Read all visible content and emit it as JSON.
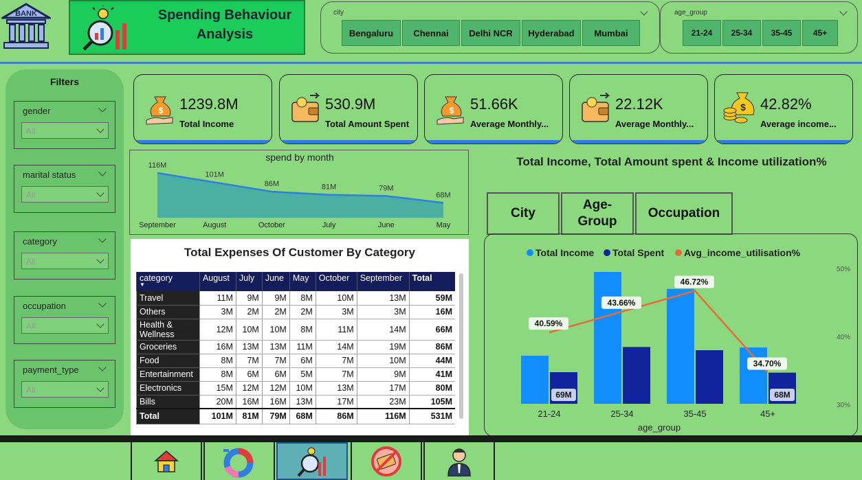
{
  "header": {
    "bank_logo_text": "BANK",
    "title_line1": "Spending Behaviour",
    "title_line2": "Analysis"
  },
  "slicers": {
    "city": {
      "label": "city",
      "options": [
        "Bengaluru",
        "Chennai",
        "Delhi NCR",
        "Hyderabad",
        "Mumbai"
      ]
    },
    "age_group": {
      "label": "age_group",
      "options": [
        "21-24",
        "25-34",
        "35-45",
        "45+"
      ]
    }
  },
  "filters": {
    "title": "Filters",
    "items": [
      {
        "label": "gender",
        "value": "All"
      },
      {
        "label": "marital status",
        "value": "All"
      },
      {
        "label": "category",
        "value": "All"
      },
      {
        "label": "occupation",
        "value": "All"
      },
      {
        "label": "payment_type",
        "value": "All"
      }
    ]
  },
  "kpis": [
    {
      "value": "1239.8M",
      "label": "Total Income",
      "icon": "money-bag-hand-icon"
    },
    {
      "value": "530.9M",
      "label": "Total Amount Spent",
      "icon": "wallet-icon"
    },
    {
      "value": "51.66K",
      "label": "Average Monthly...",
      "icon": "money-bag-hand-icon"
    },
    {
      "value": "22.12K",
      "label": "Average Monthly...",
      "icon": "wallet-icon"
    },
    {
      "value": "42.82%",
      "label": "Average income...",
      "icon": "gold-coins-icon"
    }
  ],
  "spend_chart": {
    "title": "spend by month",
    "chart_data": {
      "type": "area",
      "categories": [
        "September",
        "August",
        "October",
        "July",
        "June",
        "May"
      ],
      "values": [
        116,
        101,
        86,
        81,
        79,
        68
      ],
      "data_labels": [
        "116M",
        "101M",
        "86M",
        "81M",
        "79M",
        "68M"
      ],
      "ylim": [
        0,
        130
      ]
    }
  },
  "expenses_table": {
    "title": "Total Expenses Of Customer By Category",
    "columns": [
      "category",
      "August",
      "July",
      "June",
      "May",
      "October",
      "September",
      "Total"
    ],
    "rows": [
      [
        "Travel",
        "11M",
        "9M",
        "9M",
        "8M",
        "10M",
        "13M",
        "59M"
      ],
      [
        "Others",
        "3M",
        "2M",
        "2M",
        "2M",
        "3M",
        "3M",
        "16M"
      ],
      [
        "Health & Wellness",
        "12M",
        "10M",
        "10M",
        "8M",
        "11M",
        "14M",
        "66M"
      ],
      [
        "Groceries",
        "16M",
        "13M",
        "13M",
        "11M",
        "14M",
        "19M",
        "86M"
      ],
      [
        "Food",
        "8M",
        "7M",
        "7M",
        "6M",
        "7M",
        "10M",
        "44M"
      ],
      [
        "Entertainment",
        "8M",
        "6M",
        "6M",
        "5M",
        "7M",
        "9M",
        "41M"
      ],
      [
        "Electronics",
        "15M",
        "12M",
        "12M",
        "10M",
        "13M",
        "17M",
        "80M"
      ],
      [
        "Bills",
        "20M",
        "16M",
        "16M",
        "13M",
        "17M",
        "23M",
        "105M"
      ]
    ],
    "total_row": [
      "Total",
      "101M",
      "81M",
      "79M",
      "68M",
      "86M",
      "116M",
      "531M"
    ]
  },
  "combo": {
    "title": "Total Income, Total Amount spent & Income utilization%",
    "buttons": [
      "City",
      "Age-Group",
      "Occupation"
    ],
    "legend": [
      "Total Income",
      "Total Spent",
      "Avg_income_utilisation%"
    ],
    "colors": {
      "income": "#118dff",
      "spent": "#12239e",
      "line": "#e66c37"
    },
    "chart_data": {
      "type": "bar",
      "xlabel": "age_group",
      "categories": [
        "21-24",
        "25-34",
        "35-45",
        "45+"
      ],
      "series": [
        {
          "name": "Total Income",
          "values": [
            105,
            288,
            251,
            123
          ]
        },
        {
          "name": "Total Spent",
          "values": [
            69,
            124,
            117,
            68
          ]
        },
        {
          "name": "Avg_income_utilisation%",
          "values": [
            40.59,
            43.66,
            46.72,
            34.7
          ]
        }
      ],
      "spent_labels": [
        "69M",
        "",
        "",
        "68M"
      ],
      "line_labels": [
        "40.59%",
        "43.66%",
        "46.72%",
        "34.70%"
      ],
      "y2_ticks": [
        "50%",
        "40%",
        "30%"
      ],
      "y2lim": [
        30,
        50
      ]
    }
  },
  "nav": {
    "items": [
      "home-icon",
      "donut-chart-icon",
      "analysis-icon",
      "no-card-icon",
      "customer-icon"
    ],
    "active": 2
  }
}
